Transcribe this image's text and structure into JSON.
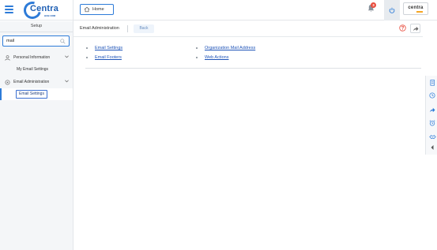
{
  "header": {
    "logo_text": "Centra",
    "logo_sub": "HUB CRM",
    "home_label": "Home",
    "notification_count": "3",
    "company_logo_text": "centra"
  },
  "sidebar": {
    "title": "Setup",
    "search_value": "mail",
    "sections": [
      {
        "label": "Personal Information",
        "icon": "person-icon",
        "sub_items": [
          "My Email Settings"
        ]
      },
      {
        "label": "Email Administration",
        "icon": "gear-icon",
        "sub_items": [
          "Email Settings"
        ]
      }
    ],
    "active_item": "Email Settings"
  },
  "content": {
    "title": "Email Administration",
    "back_label": "Back",
    "links_left": [
      "Email Settings",
      "Email Footers"
    ],
    "links_right": [
      "Organization Mail Address",
      "Web Actions"
    ]
  },
  "right_toolbar": {
    "icons": [
      "document-icon",
      "clock-icon",
      "share-arrow-icon",
      "alarm-icon",
      "handshake-icon",
      "chevron-left-icon"
    ]
  },
  "colors": {
    "accent": "#2d7bd8",
    "link": "#1f54b8",
    "badge": "#e84c3d",
    "sidebar_bg": "#f4f6f8"
  }
}
